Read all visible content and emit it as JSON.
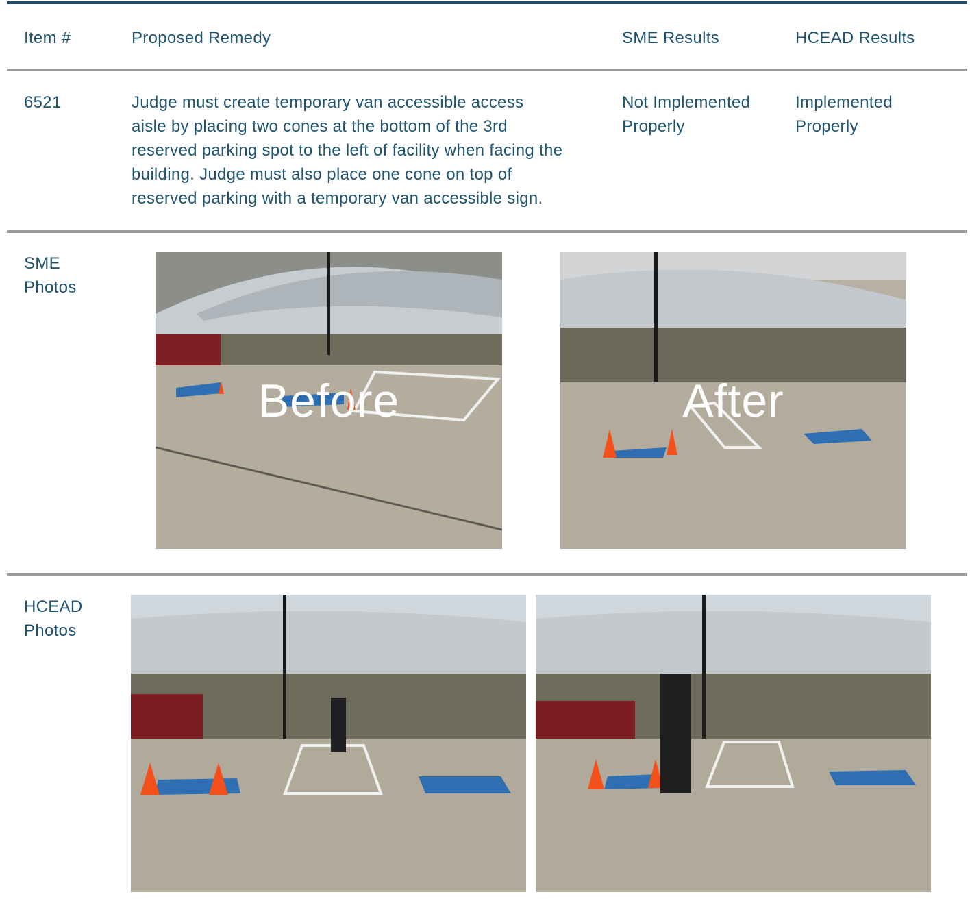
{
  "header": {
    "item": "Item #",
    "remedy": "Proposed Remedy",
    "sme": "SME Results",
    "hcead": "HCEAD Results"
  },
  "row": {
    "item_number": "6521",
    "remedy_lines": [
      "Judge must create temporary van accessible access",
      "aisle by placing two cones at the bottom of the 3rd",
      "reserved parking spot to the left of facility when facing the",
      "building. Judge must also place one cone on top of",
      "reserved parking with a temporary van accessible sign."
    ],
    "sme_result_lines": [
      "Not Implemented",
      "Properly"
    ],
    "hcead_result_lines": [
      "Implemented",
      "Properly"
    ]
  },
  "sme_photos": {
    "label_lines": [
      "SME",
      "Photos"
    ],
    "before_label": "Before",
    "after_label": "After"
  },
  "hcead_photos": {
    "label_lines": [
      "HCEAD",
      "Photos"
    ]
  }
}
